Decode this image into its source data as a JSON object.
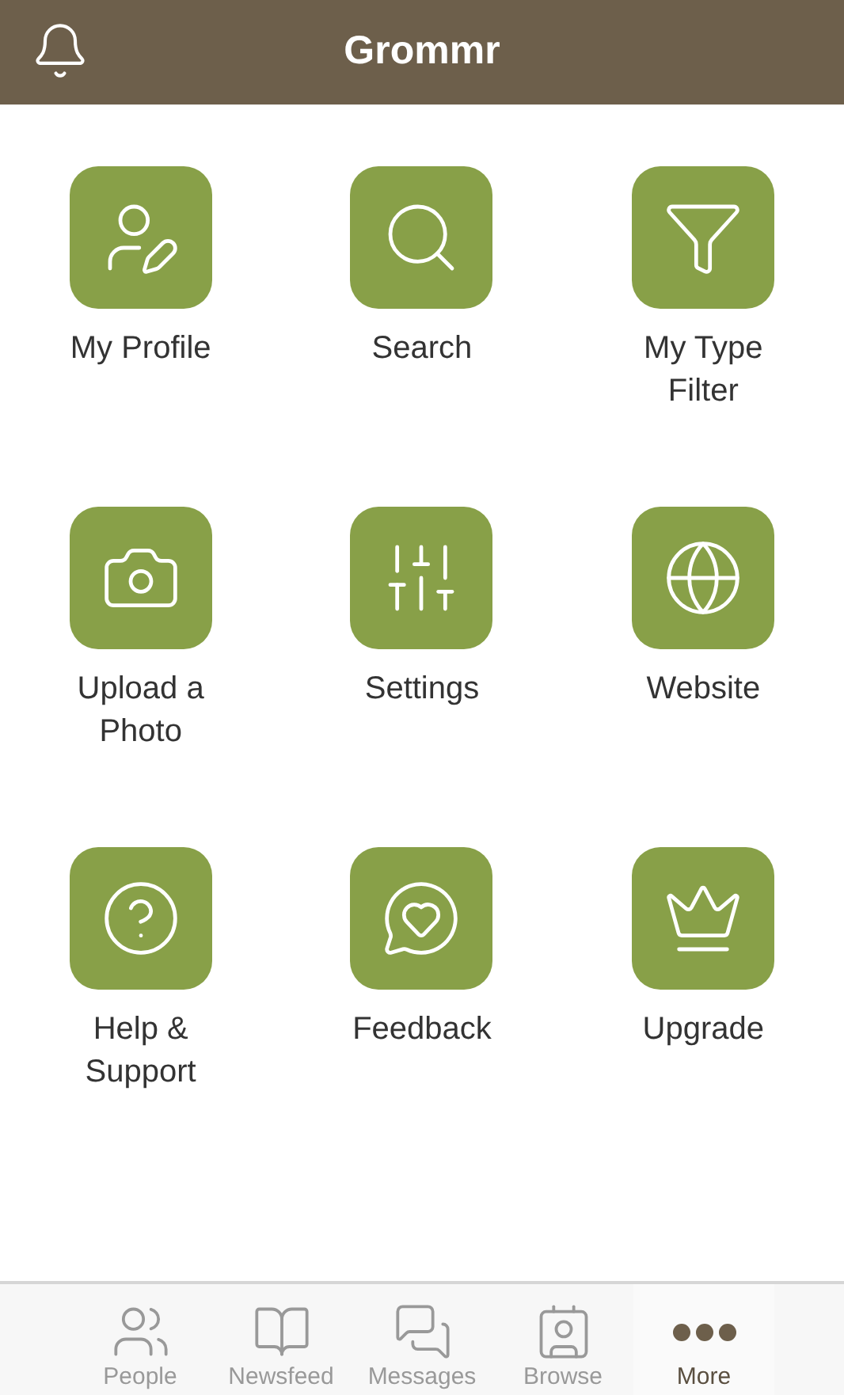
{
  "header": {
    "title": "Grommr"
  },
  "menu": [
    {
      "label": "My Profile"
    },
    {
      "label": "Search"
    },
    {
      "label": "My Type Filter"
    },
    {
      "label": "Upload a Photo"
    },
    {
      "label": "Settings"
    },
    {
      "label": "Website"
    },
    {
      "label": "Help & Support"
    },
    {
      "label": "Feedback"
    },
    {
      "label": "Upgrade"
    }
  ],
  "tab_bar": [
    {
      "label": "People",
      "selected": false
    },
    {
      "label": "Newsfeed",
      "selected": false
    },
    {
      "label": "Messages",
      "selected": false
    },
    {
      "label": "Browse",
      "selected": false
    },
    {
      "label": "More",
      "selected": true
    }
  ]
}
